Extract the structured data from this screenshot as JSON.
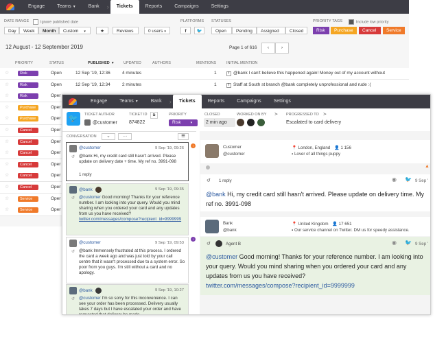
{
  "back": {
    "nav": {
      "engage": "Engage",
      "teams": "Teams",
      "bank": "Bank",
      "tickets": "Tickets",
      "reports": "Reports",
      "campaigns": "Campaigns",
      "settings": "Settings"
    },
    "filters": {
      "date_range_label": "Date range",
      "ignore_published": "Ignore published date",
      "day": "Day",
      "week": "Week",
      "month": "Month",
      "custom": "Custom",
      "reviews": "Reviews",
      "users": "0 users",
      "platforms_label": "Platforms",
      "statuses_label": "Statuses",
      "open": "Open",
      "pending": "Pending",
      "assigned": "Assigned",
      "closed": "Closed",
      "priority_tags_label": "Priority tags",
      "include_low_priority": "Include low priority",
      "risk": "Risk",
      "purchase": "Purchase",
      "cancel": "Cancel",
      "service": "Service"
    },
    "date_range_text": "12 August - 12 September 2019",
    "page_text": "Page 1 of 616",
    "columns": {
      "priority": "Priority",
      "status": "Status",
      "published": "Published",
      "updated": "Updated",
      "authors": "Authors",
      "mentions": "Mentions",
      "initial": "Initial mention"
    },
    "rows": [
      {
        "priority": "Risk",
        "status": "Open",
        "published": "12 Sep '19, 12:36",
        "updated": "4 minutes",
        "mentions": "1",
        "mention": "@bank I can't believe this happened again! Money out of my account without"
      },
      {
        "priority": "Risk",
        "status": "Open",
        "published": "12 Sep '19, 12:34",
        "updated": "2 minutes",
        "mentions": "1",
        "mention": "Staff at South st branch @bank completely unprofessional and rude :("
      },
      {
        "priority": "Risk",
        "status": "Oper",
        "published": "",
        "updated": "",
        "mentions": "",
        "mention": ""
      },
      {
        "priority": "Purchase",
        "status": "Oper",
        "published": "",
        "updated": "",
        "mentions": "",
        "mention": ""
      },
      {
        "priority": "Purchase",
        "status": "Oper",
        "published": "",
        "updated": "",
        "mentions": "",
        "mention": ""
      },
      {
        "priority": "Cancel",
        "status": "Oper",
        "published": "",
        "updated": "",
        "mentions": "",
        "mention": ""
      },
      {
        "priority": "Cancel",
        "status": "Oper",
        "published": "",
        "updated": "",
        "mentions": "",
        "mention": ""
      },
      {
        "priority": "Cancel",
        "status": "Oper",
        "published": "",
        "updated": "",
        "mentions": "",
        "mention": ""
      },
      {
        "priority": "Cancel",
        "status": "Oper",
        "published": "",
        "updated": "",
        "mentions": "",
        "mention": ""
      },
      {
        "priority": "Cancel",
        "status": "Oper",
        "published": "",
        "updated": "",
        "mentions": "",
        "mention": ""
      },
      {
        "priority": "Cancel",
        "status": "Oper",
        "published": "",
        "updated": "",
        "mentions": "",
        "mention": ""
      },
      {
        "priority": "Service",
        "status": "Oper",
        "published": "",
        "updated": "",
        "mentions": "",
        "mention": ""
      },
      {
        "priority": "Service",
        "status": "Oper",
        "published": "",
        "updated": "",
        "mentions": "",
        "mention": ""
      }
    ]
  },
  "front": {
    "nav": {
      "engage": "Engage",
      "teams": "Teams",
      "bank": "Bank",
      "tickets": "Tickets",
      "reports": "Reports",
      "campaigns": "Campaigns",
      "settings": "Settings"
    },
    "ticket": {
      "author_label": "Ticket author",
      "author": "@customer",
      "id_label": "Ticket ID",
      "id": "874822",
      "priority_label": "Priority",
      "priority": "Risk",
      "closed_label": "Closed",
      "closed": "2 min ago",
      "worked_label": "Worked on by",
      "progressed_label": "Progressed to",
      "progressed": "Escalated to card delivery"
    },
    "conversation_label": "Conversation",
    "messages": [
      {
        "handle": "@customer",
        "time": "9 Sep '19, 09:26",
        "body": "@bank Hi, my credit card still hasn't arrived. Please update on delivery date + time. My ref no. 3991-098",
        "reply": "1 reply"
      },
      {
        "handle": "@bank",
        "time": "9 Sep '19, 09:35",
        "body_mention": "@customer",
        "body": " Good morning! Thanks for your reference number. I am looking into your query. Would you mind sharing when you ordered your card and any updates from us you have received?",
        "link": "twitter.com/messages/compose?recipient_id=9999999"
      },
      {
        "handle": "@customer",
        "time": "9 Sep '19, 09:53",
        "body": "@bank Immensely frustrated at this process. I ordered the card a week ago and was just told by your call centre that it wasn't processed due to a system error. So poor from you guys. I'm still without a card and no apology."
      },
      {
        "handle": "@bank",
        "time": "9 Sep '19, 10:27",
        "body_mention": "@customer",
        "body": " I'm so sorry for this inconvenience. I can see your order has been processed. Delivery usually takes 7 days but I have escalated your order and have requested that delivery be made"
      }
    ],
    "customer": {
      "name": "Customer",
      "handle": "@customer",
      "location": "London, England",
      "followers": "1 156",
      "bio": "Lover of all things puppy",
      "reply": "1 reply",
      "time": "9 Sep '",
      "mention": "@bank",
      "message": " Hi, my credit card still hasn't arrived. Please update on delivery time. My ref no. 3991-098"
    },
    "bank": {
      "name": "Bank",
      "handle": "@bank",
      "location": "United Kingdom",
      "followers": "17 651",
      "bio": "Our service channel on Twitter. DM us for speedy assistance.",
      "agent": "Agent B",
      "time": "9 Sep '",
      "mention": "@customer",
      "message": " Good morning! Thanks for your reference number. I am looking into your query. Would you mind sharing when you ordered your card and any updates from us you have received?",
      "link": "twitter.com/messages/compose?recipient_id=9999999"
    }
  },
  "colors": {
    "risk": "#7c3fae",
    "purchase": "#f5a623",
    "cancel": "#d73a3a",
    "service": "#f07a2a",
    "nav": "#3d3d45",
    "link": "#2c5aa0"
  }
}
